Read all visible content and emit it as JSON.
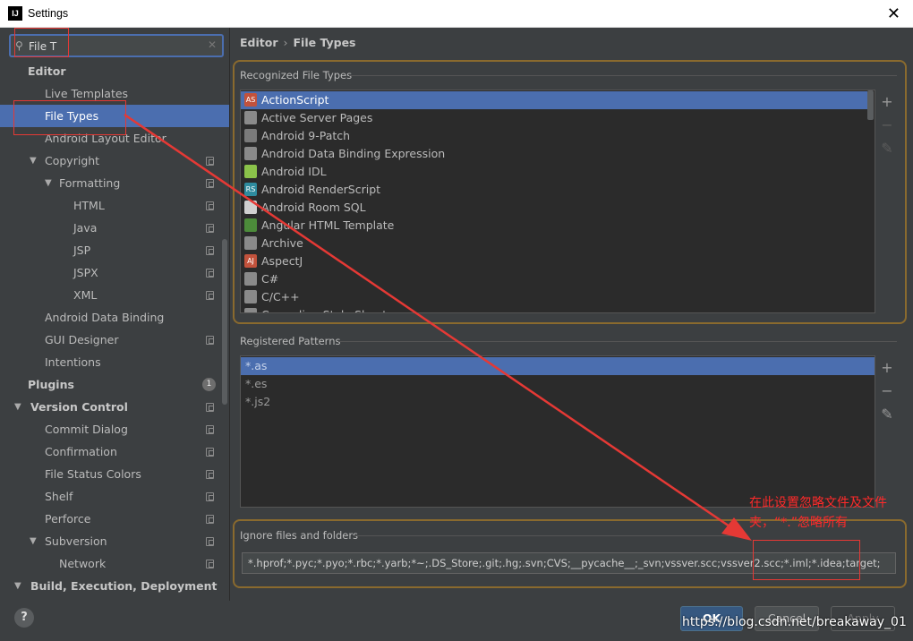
{
  "window": {
    "title": "Settings",
    "logo": "IJ",
    "close_label": "✕"
  },
  "search": {
    "value": "File T"
  },
  "sidebar": {
    "items": [
      {
        "label": "Editor",
        "level": 0,
        "bold": true,
        "arrow": "",
        "copy": false
      },
      {
        "label": "Live Templates",
        "level": 1,
        "bold": false,
        "arrow": "",
        "copy": false
      },
      {
        "label": "File Types",
        "level": 1,
        "bold": false,
        "arrow": "",
        "copy": false,
        "selected": true
      },
      {
        "label": "Android Layout Editor",
        "level": 1,
        "bold": false,
        "arrow": "",
        "copy": false
      },
      {
        "label": "Copyright",
        "level": 1,
        "bold": false,
        "arrow": "▼",
        "copy": true
      },
      {
        "label": "Formatting",
        "level": 2,
        "bold": false,
        "arrow": "▼",
        "copy": true
      },
      {
        "label": "HTML",
        "level": 3,
        "bold": false,
        "arrow": "",
        "copy": true
      },
      {
        "label": "Java",
        "level": 3,
        "bold": false,
        "arrow": "",
        "copy": true
      },
      {
        "label": "JSP",
        "level": 3,
        "bold": false,
        "arrow": "",
        "copy": true
      },
      {
        "label": "JSPX",
        "level": 3,
        "bold": false,
        "arrow": "",
        "copy": true
      },
      {
        "label": "XML",
        "level": 3,
        "bold": false,
        "arrow": "",
        "copy": true
      },
      {
        "label": "Android Data Binding",
        "level": 1,
        "bold": false,
        "arrow": "",
        "copy": false
      },
      {
        "label": "GUI Designer",
        "level": 1,
        "bold": false,
        "arrow": "",
        "copy": true
      },
      {
        "label": "Intentions",
        "level": 1,
        "bold": false,
        "arrow": "",
        "copy": false
      },
      {
        "label": "Plugins",
        "level": 0,
        "bold": true,
        "arrow": "",
        "copy": false,
        "badge": "1"
      },
      {
        "label": "Version Control",
        "level": 0,
        "bold": true,
        "arrow": "▼",
        "copy": true
      },
      {
        "label": "Commit Dialog",
        "level": 1,
        "bold": false,
        "arrow": "",
        "copy": true
      },
      {
        "label": "Confirmation",
        "level": 1,
        "bold": false,
        "arrow": "",
        "copy": true
      },
      {
        "label": "File Status Colors",
        "level": 1,
        "bold": false,
        "arrow": "",
        "copy": true
      },
      {
        "label": "Shelf",
        "level": 1,
        "bold": false,
        "arrow": "",
        "copy": true
      },
      {
        "label": "Perforce",
        "level": 1,
        "bold": false,
        "arrow": "",
        "copy": true
      },
      {
        "label": "Subversion",
        "level": 1,
        "bold": false,
        "arrow": "▼",
        "copy": true
      },
      {
        "label": "Network",
        "level": 2,
        "bold": false,
        "arrow": "",
        "copy": true
      },
      {
        "label": "Build, Execution, Deployment",
        "level": 0,
        "bold": true,
        "arrow": "▼",
        "copy": false
      }
    ]
  },
  "breadcrumb": {
    "parent": "Editor",
    "separator": "›",
    "current": "File Types"
  },
  "recognized": {
    "label": "Recognized File Types",
    "items": [
      {
        "label": "ActionScript",
        "icon": "actionscript-icon",
        "glyph": "AS",
        "color": "#c2523c",
        "selected": true
      },
      {
        "label": "Active Server Pages",
        "icon": "asp-icon",
        "glyph": "",
        "color": "#8a8a8a"
      },
      {
        "label": "Android 9-Patch",
        "icon": "folder-icon",
        "glyph": "",
        "color": "#7a7a7a"
      },
      {
        "label": "Android Data Binding Expression",
        "icon": "databinding-icon",
        "glyph": "",
        "color": "#8a8a8a"
      },
      {
        "label": "Android IDL",
        "icon": "android-icon",
        "glyph": "",
        "color": "#8bc34a"
      },
      {
        "label": "Android RenderScript",
        "icon": "renderscript-icon",
        "glyph": "RS",
        "color": "#2e8b9e"
      },
      {
        "label": "Android Room SQL",
        "icon": "sql-icon",
        "glyph": "",
        "color": "#d0d0d0"
      },
      {
        "label": "Angular HTML Template",
        "icon": "angular-html-icon",
        "glyph": "",
        "color": "#4c8b3a"
      },
      {
        "label": "Archive",
        "icon": "archive-icon",
        "glyph": "",
        "color": "#8a8a8a"
      },
      {
        "label": "AspectJ",
        "icon": "aspectj-icon",
        "glyph": "AJ",
        "color": "#c2523c"
      },
      {
        "label": "C#",
        "icon": "csharp-icon",
        "glyph": "",
        "color": "#8a8a8a"
      },
      {
        "label": "C/C++",
        "icon": "cpp-icon",
        "glyph": "",
        "color": "#8a8a8a"
      },
      {
        "label": "Cascading Style Sheet",
        "icon": "css-icon",
        "glyph": "",
        "color": "#8a8a8a"
      }
    ]
  },
  "patterns": {
    "label": "Registered Patterns",
    "items": [
      {
        "label": "*.as",
        "selected": true
      },
      {
        "label": "*.es"
      },
      {
        "label": "*.js2"
      }
    ]
  },
  "tools": {
    "add": "+",
    "remove": "−",
    "edit": "✎"
  },
  "ignore": {
    "label": "Ignore files and folders",
    "value": "*.hprof;*.pyc;*.pyo;*.rbc;*.yarb;*~;.DS_Store;.git;.hg;.svn;CVS;__pycache__;_svn;vssver.scc;vssver2.scc;*.iml;*.idea;target;"
  },
  "annotation": {
    "text": "在此设置忽略文件及文件夹，“*.”忽略所有"
  },
  "footer": {
    "help": "?",
    "ok": "OK",
    "cancel": "Cancel",
    "apply": "Apply",
    "watermark": "https://blog.csdn.net/breakaway_01"
  },
  "colors": {
    "accent": "#4b6eaf",
    "annotation": "#ff2a2a",
    "group_border": "#8a6a2e"
  }
}
